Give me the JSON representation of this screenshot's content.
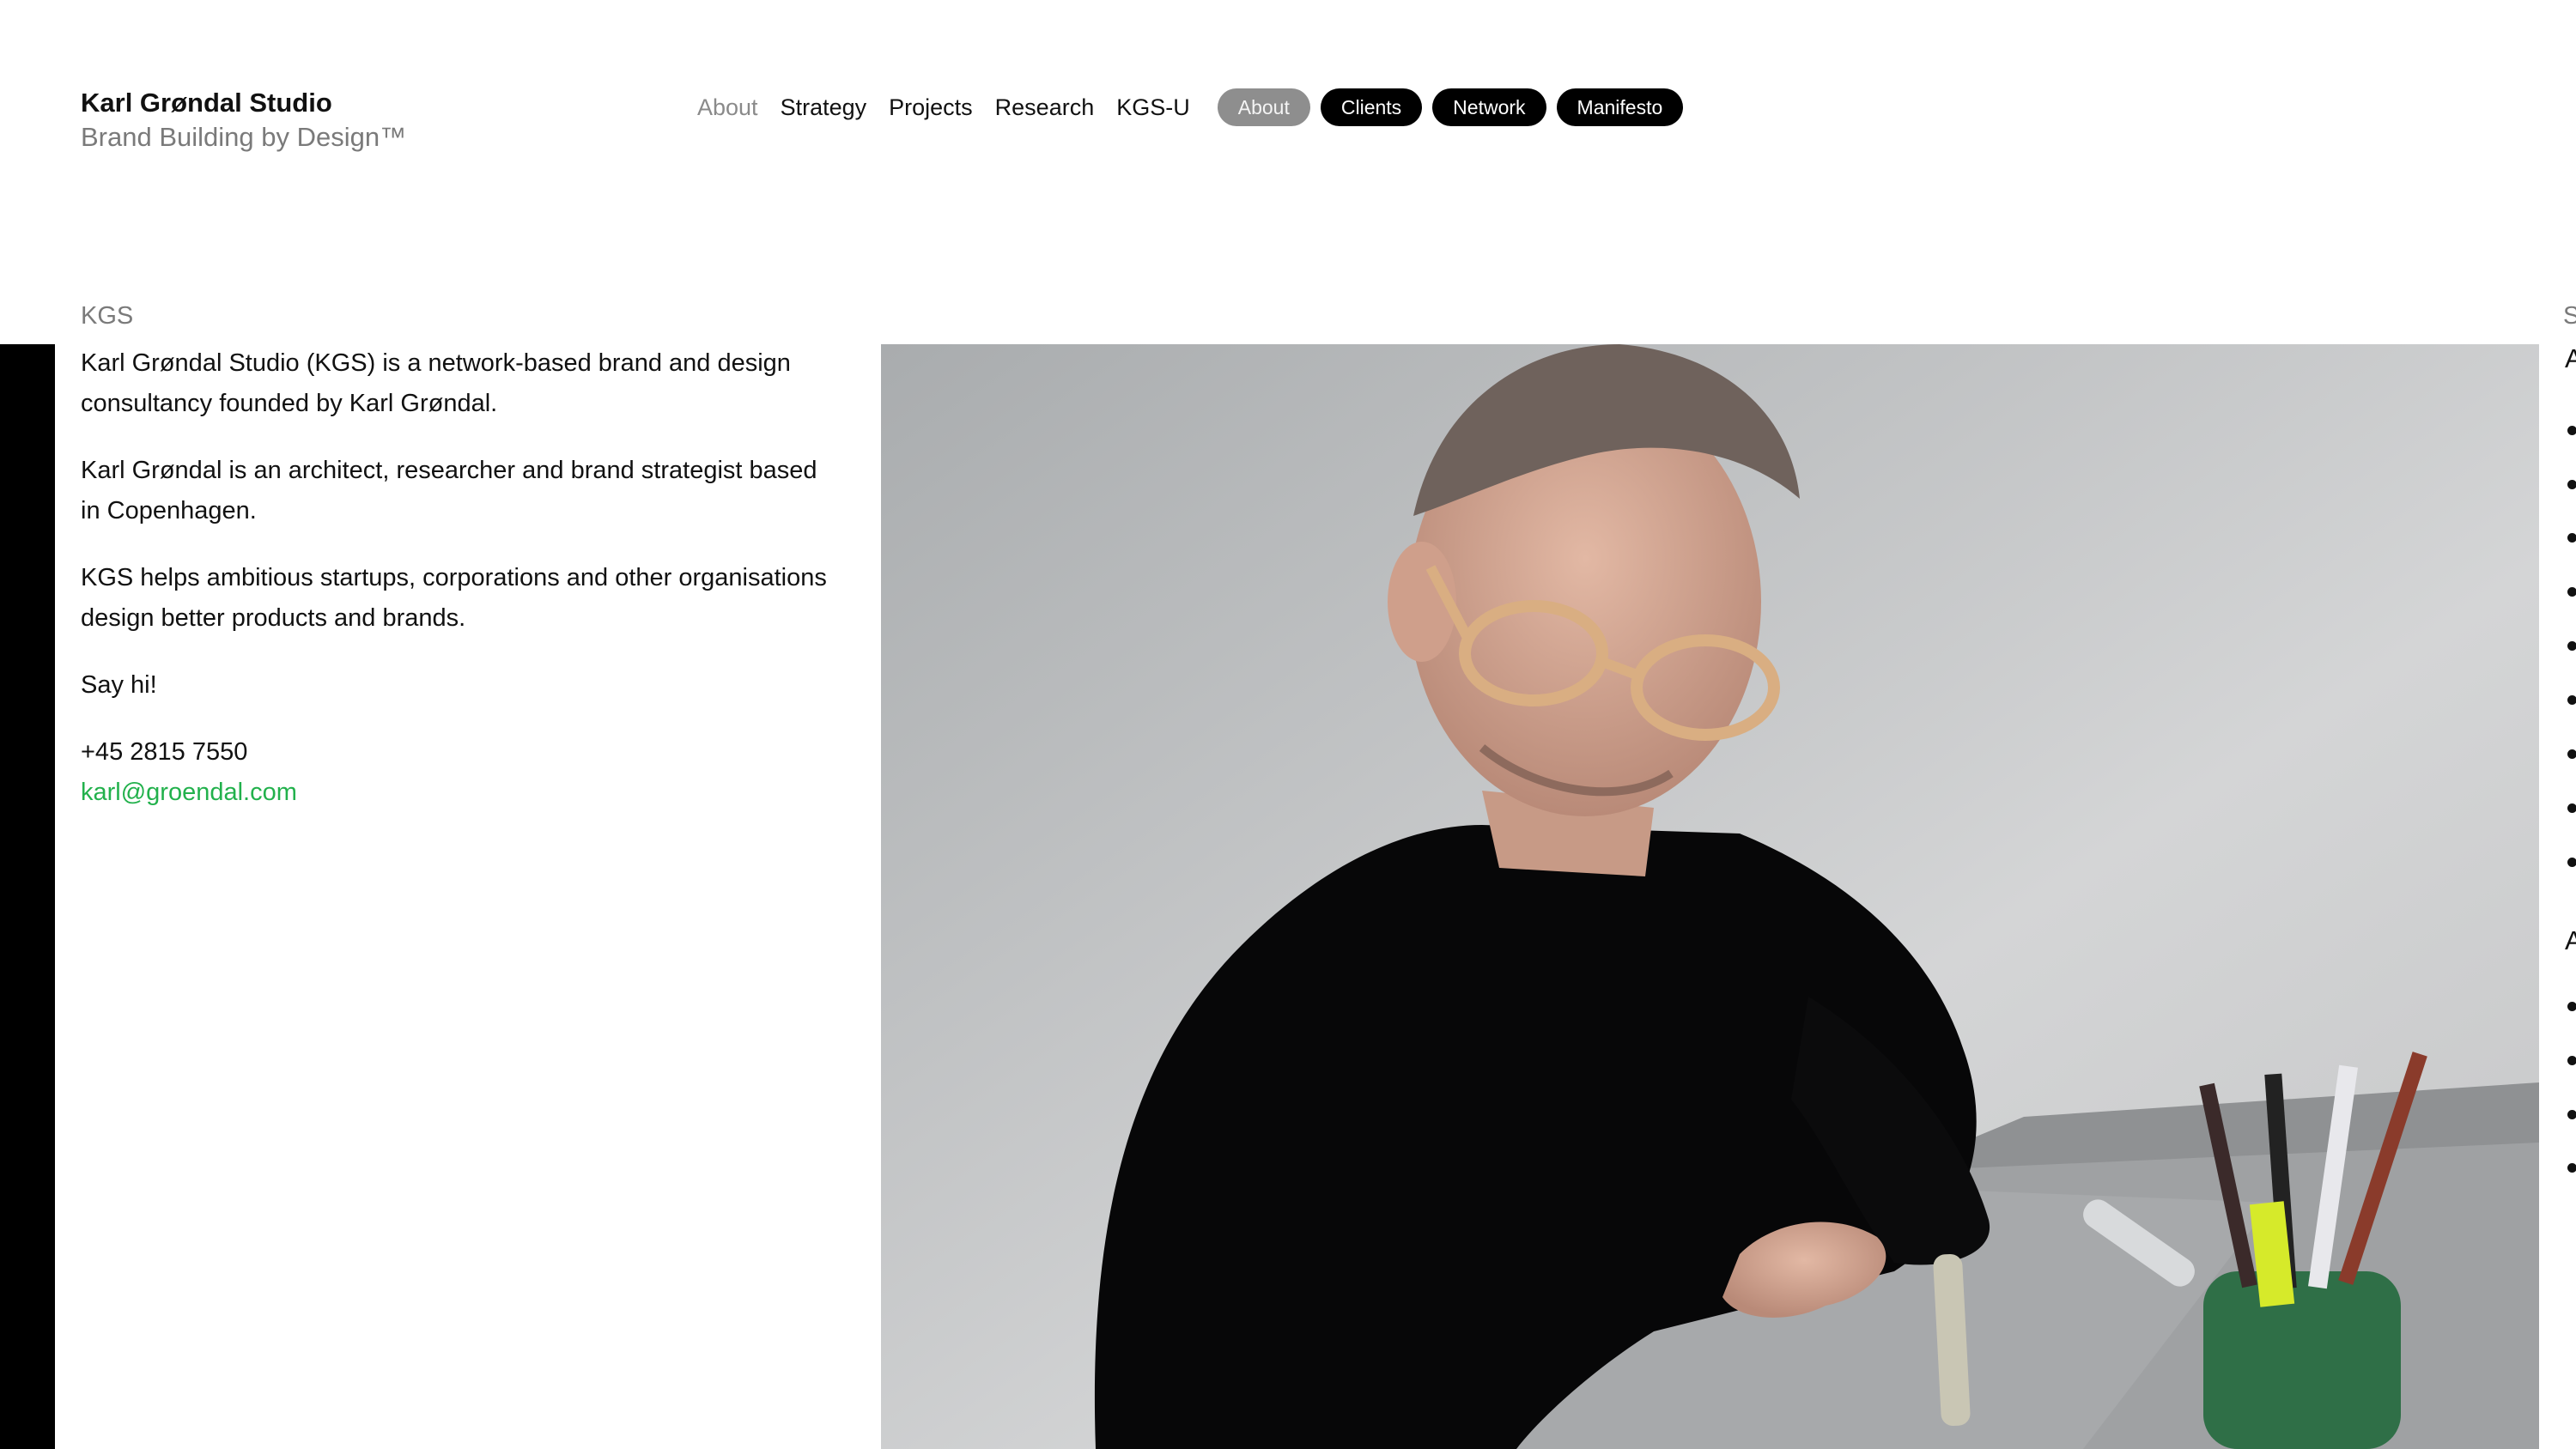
{
  "brand": {
    "name": "Karl Grøndal Studio",
    "tagline": "Brand Building by Design™"
  },
  "nav": {
    "links": [
      {
        "label": "About",
        "active": true
      },
      {
        "label": "Strategy",
        "active": false
      },
      {
        "label": "Projects",
        "active": false
      },
      {
        "label": "Research",
        "active": false
      },
      {
        "label": "KGS-U",
        "active": false
      }
    ],
    "pills": [
      {
        "label": "About",
        "active": true
      },
      {
        "label": "Clients",
        "active": false
      },
      {
        "label": "Network",
        "active": false
      },
      {
        "label": "Manifesto",
        "active": false
      }
    ]
  },
  "section": {
    "label": "KGS"
  },
  "intro": {
    "paragraphs": [
      "Karl Grøndal Studio (KGS) is a network-based brand and design consultancy founded by Karl Grøndal.",
      "Karl Grøndal is an architect, researcher and brand strategist based in Copenhagen.",
      "KGS helps ambitious startups, corporations and other organisations design better products and brands.",
      "Say hi!"
    ],
    "phone": "+45 2815 7550",
    "email": "karl@groendal.com"
  },
  "photo": {
    "subject": "portrait-karl-drawing-at-desk"
  },
  "right_column": {
    "label": "S",
    "headings": [
      "A",
      "A"
    ]
  },
  "colors": {
    "accent_link": "#22b14c",
    "pill_bg": "#000000",
    "pill_active_bg": "#8e8e8e",
    "muted_text": "#7a7a7a"
  }
}
